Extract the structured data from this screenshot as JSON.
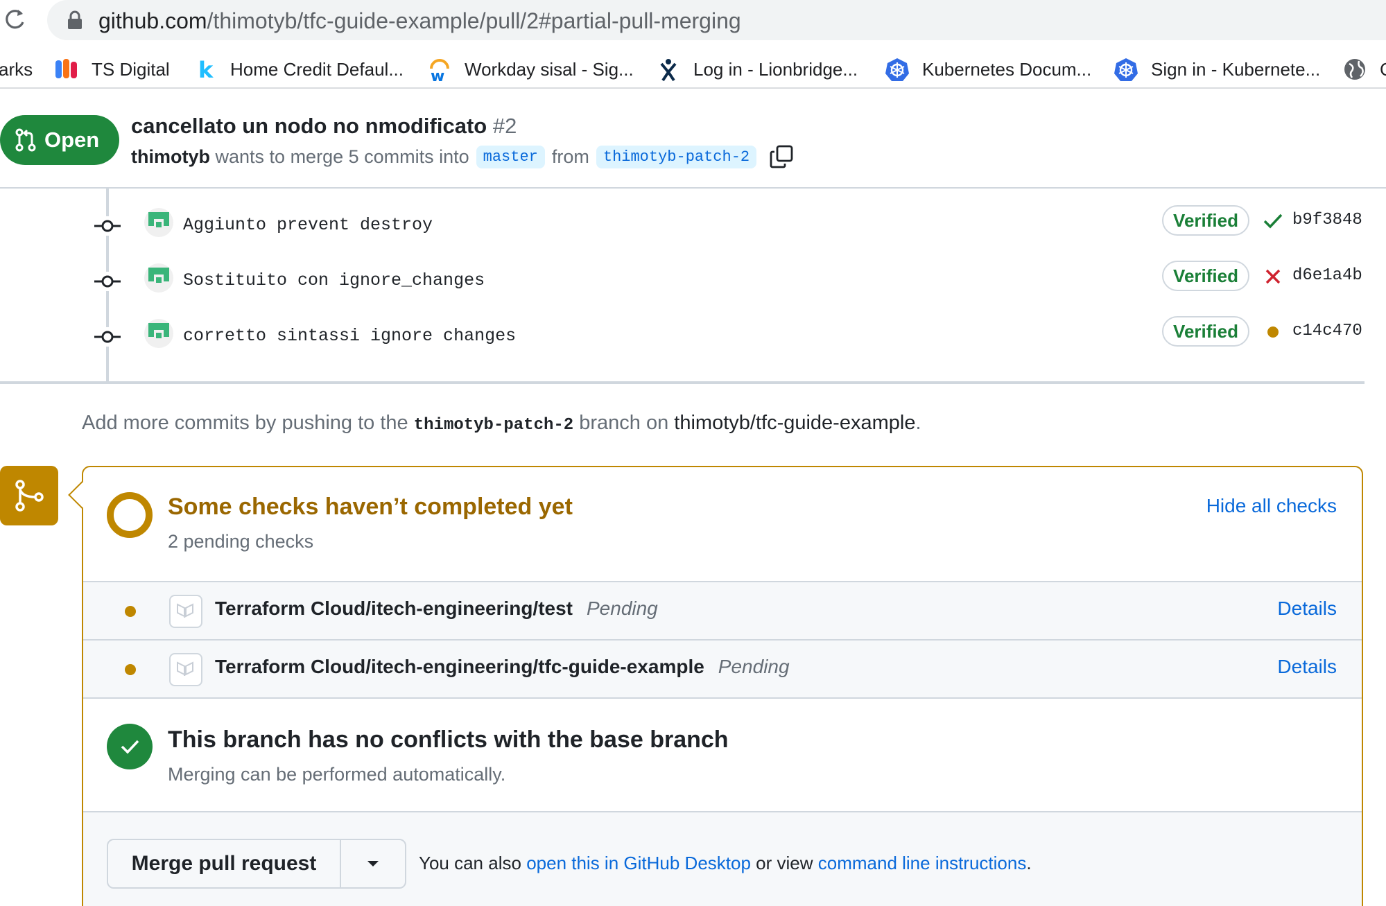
{
  "browser": {
    "url_host": "github.com",
    "url_path": "/thimotyb/tfc-guide-example/pull/2#partial-pull-merging",
    "bookmarks": [
      {
        "label": "arks",
        "icon": "none"
      },
      {
        "label": "TS Digital",
        "icon": "ts-digital-icon"
      },
      {
        "label": "Home Credit Defaul...",
        "icon": "kaggle-icon"
      },
      {
        "label": "Workday sisal - Sig...",
        "icon": "workday-icon"
      },
      {
        "label": "Log in - Lionbridge...",
        "icon": "lionbridge-icon"
      },
      {
        "label": "Kubernetes Docum...",
        "icon": "kubernetes-icon"
      },
      {
        "label": "Sign in - Kubernete...",
        "icon": "kubernetes-icon"
      },
      {
        "label": "C",
        "icon": "globe-icon"
      }
    ]
  },
  "pr": {
    "state": "Open",
    "title": "cancellato un nodo no nmodificato",
    "number": "#2",
    "author": "thimotyb",
    "meta_text": "wants to merge 5 commits into",
    "base_branch": "master",
    "from_text": "from",
    "head_branch": "thimotyb-patch-2"
  },
  "commits": [
    {
      "message": "Aggiunto prevent destroy",
      "verified": "Verified",
      "status": "success",
      "sha": "b9f3848"
    },
    {
      "message": "Sostituito con ignore_changes",
      "verified": "Verified",
      "status": "failure",
      "sha": "d6e1a4b"
    },
    {
      "message": "corretto sintassi ignore changes",
      "verified": "Verified",
      "status": "pending",
      "sha": "c14c470"
    }
  ],
  "push_note": {
    "prefix": "Add more commits by pushing to the",
    "branch": "thimotyb-patch-2",
    "middle": "branch on",
    "repo": "thimotyb/tfc-guide-example",
    "suffix": "."
  },
  "checks": {
    "title": "Some checks haven’t completed yet",
    "subtitle": "2 pending checks",
    "hide_label": "Hide all checks",
    "items": [
      {
        "name": "Terraform Cloud/itech-engineering/test",
        "state": "Pending",
        "details": "Details"
      },
      {
        "name": "Terraform Cloud/itech-engineering/tfc-guide-example",
        "state": "Pending",
        "details": "Details"
      }
    ]
  },
  "conflicts": {
    "title": "This branch has no conflicts with the base branch",
    "subtitle": "Merging can be performed automatically."
  },
  "merge": {
    "button_label": "Merge pull request",
    "also_prefix": "You can also",
    "desktop_link": "open this in GitHub Desktop",
    "or_view": "or view",
    "cli_link": "command line instructions",
    "suffix": "."
  },
  "colors": {
    "open_green": "#1f883d",
    "pending_yellow": "#bf8700",
    "link_blue": "#0969da",
    "fail_red": "#cf222e"
  }
}
